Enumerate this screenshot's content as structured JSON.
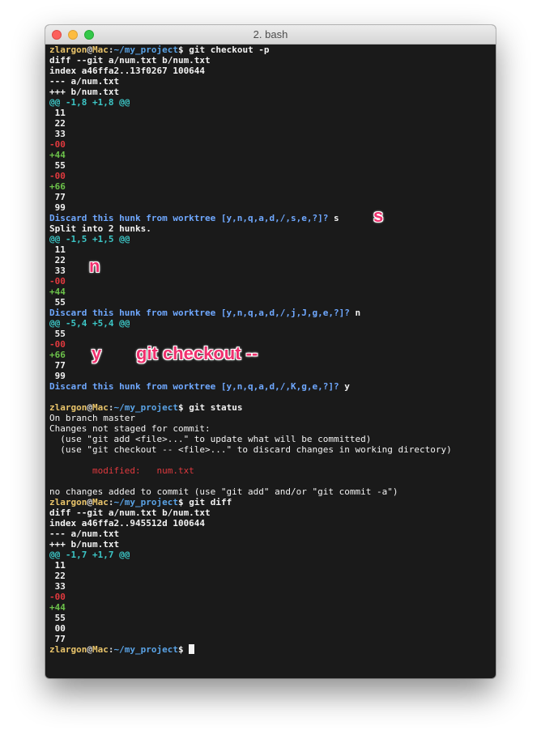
{
  "window": {
    "title": "2. bash"
  },
  "prompt": {
    "user": "zlargon",
    "at": "@",
    "host": "Mac",
    "colon": ":",
    "path": "~/my_project",
    "dollar": "$"
  },
  "lines": {
    "l1_cmd": "git checkout -p",
    "l2": "diff --git a/num.txt b/num.txt",
    "l3": "index a46ffa2..13f0267 100644",
    "l4": "--- a/num.txt",
    "l5": "+++ b/num.txt",
    "l6": "@@ -1,8 +1,8 @@",
    "l7": " 11",
    "l8": " 22",
    "l9": " 33",
    "l10": "-00",
    "l11": "+44",
    "l12": " 55",
    "l13": "-00",
    "l14": "+66",
    "l15": " 77",
    "l16": " 99",
    "l17_q": "Discard this hunk from worktree [y,n,q,a,d,/,s,e,?]?",
    "l17_a": " s",
    "l18": "Split into 2 hunks.",
    "l19": "@@ -1,5 +1,5 @@",
    "l20": " 11",
    "l21": " 22",
    "l22": " 33",
    "l23": "-00",
    "l24": "+44",
    "l25": " 55",
    "l26_q": "Discard this hunk from worktree [y,n,q,a,d,/,j,J,g,e,?]?",
    "l26_a": " n",
    "l27": "@@ -5,4 +5,4 @@",
    "l28": " 55",
    "l29": "-00",
    "l30": "+66",
    "l31": " 77",
    "l32": " 99",
    "l33_q": "Discard this hunk from worktree [y,n,q,a,d,/,K,g,e,?]?",
    "l33_a": " y",
    "l35_cmd": "git status",
    "l36": "On branch master",
    "l37": "Changes not staged for commit:",
    "l38": "  (use \"git add <file>...\" to update what will be committed)",
    "l39": "  (use \"git checkout -- <file>...\" to discard changes in working directory)",
    "l41": "        modified:   num.txt",
    "l43": "no changes added to commit (use \"git add\" and/or \"git commit -a\")",
    "l44_cmd": "git diff",
    "l45": "diff --git a/num.txt b/num.txt",
    "l46": "index a46ffa2..945512d 100644",
    "l47": "--- a/num.txt",
    "l48": "+++ b/num.txt",
    "l49": "@@ -1,7 +1,7 @@",
    "l50": " 11",
    "l51": " 22",
    "l52": " 33",
    "l53": "-00",
    "l54": "+44",
    "l55": " 55",
    "l56": " 00",
    "l57": " 77"
  },
  "annotations": {
    "s": "s",
    "n": "n",
    "y": "y",
    "checkout": "git checkout --"
  },
  "colors": {
    "user": "#e9c46a",
    "path": "#5aa3e6",
    "hunk_header": "#3cc6c6",
    "removed": "#e0393e",
    "added": "#6cc24a",
    "prompt_question": "#6fa8ff",
    "annotation": "#f0306e"
  }
}
